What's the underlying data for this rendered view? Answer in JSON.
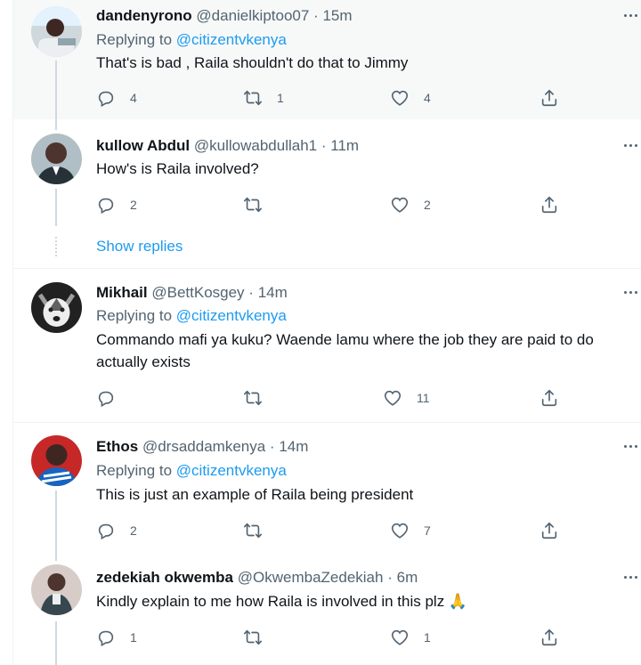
{
  "tweets": [
    {
      "name": "dandenyrono",
      "handle": "@danielkiptoo07",
      "time": "15m",
      "replying_prefix": "Replying to ",
      "replying_to": "@citizentvkenya",
      "text": "That's is bad , Raila shouldn't do that to Jimmy",
      "replies": "4",
      "retweets": "1",
      "likes": "4",
      "avatar_color": "#cfd8dc"
    },
    {
      "name": "kullow Abdul",
      "handle": "@kullowabdullah1",
      "time": "11m",
      "text": "How's is Raila involved?",
      "replies": "2",
      "retweets": "",
      "likes": "2",
      "avatar_color": "#5d4037"
    },
    {
      "name": "Mikhail",
      "handle": "@BettKosgey",
      "time": "14m",
      "replying_prefix": "Replying to ",
      "replying_to": "@citizentvkenya",
      "text": "Commando mafi ya kuku? Waende lamu where the job they are paid to do actually exists",
      "replies": "",
      "retweets": "",
      "likes": "11",
      "avatar_color": "#2b2b2b"
    },
    {
      "name": "Ethos",
      "handle": "@drsaddamkenya",
      "time": "14m",
      "replying_prefix": "Replying to ",
      "replying_to": "@citizentvkenya",
      "text": "This is just an example of Raila being president",
      "replies": "2",
      "retweets": "",
      "likes": "7",
      "avatar_color": "#c62828"
    },
    {
      "name": "zedekiah okwemba",
      "handle": "@OkwembaZedekiah",
      "time": "6m",
      "text": "Kindly explain to me how Raila is involved in this plz 🙏",
      "replies": "1",
      "retweets": "",
      "likes": "1",
      "avatar_color": "#a1887f"
    }
  ],
  "show_replies": "Show replies",
  "separator": "·",
  "icons": {
    "reply": "reply-icon",
    "retweet": "retweet-icon",
    "like": "heart-icon",
    "share": "share-icon",
    "more": "more-icon"
  },
  "colors": {
    "accent": "#1d9bf0",
    "secondary_text": "#536471",
    "border": "#eff3f4",
    "thread_line": "#cfd9de"
  }
}
